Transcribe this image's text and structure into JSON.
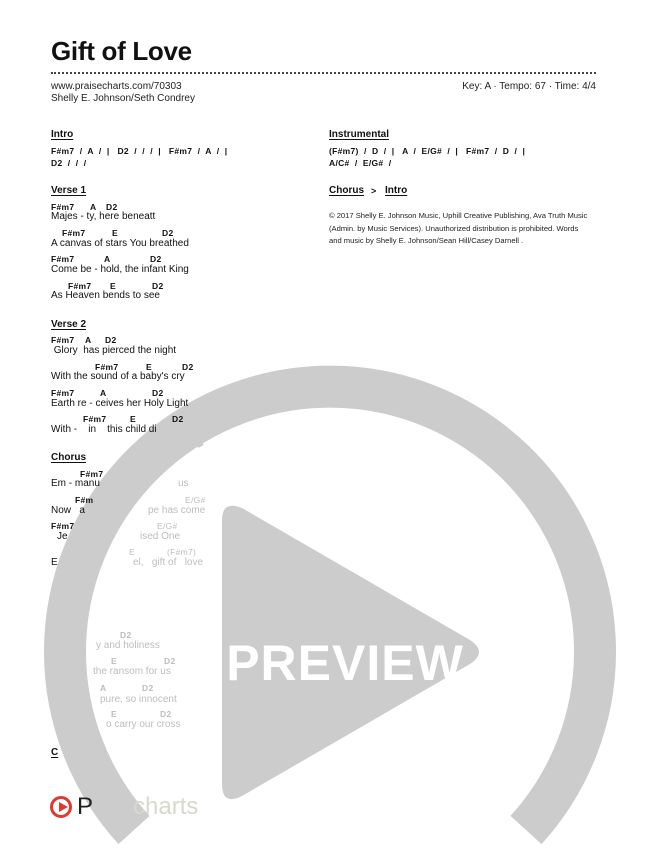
{
  "header": {
    "title": "Gift of Love",
    "url": "www.praisecharts.com/70303",
    "authors": "Shelly E. Johnson/Seth Condrey",
    "song_info": "Key: A · Tempo: 67 · Time: 4/4"
  },
  "intro": {
    "heading": "Intro",
    "lines": [
      "F#m7  /  A  /  |   D2  /  /  /  |   F#m7  /  A  /  |",
      "D2  /  /  /"
    ]
  },
  "verse1": {
    "heading": "Verse 1",
    "chords": [
      [
        "F#m7",
        "A",
        "D2"
      ],
      [
        "F#m7",
        "E",
        "D2"
      ],
      [
        "F#m7",
        "A",
        "D2"
      ],
      [
        "F#m7",
        "E",
        "D2"
      ]
    ],
    "lyrics": [
      "Majes - ty, here beneatt",
      "A canvas of stars You breathed",
      "Come be - hold, the infant King",
      "As Heaven bends to see"
    ]
  },
  "verse2": {
    "heading": "Verse 2",
    "chords": [
      [
        "F#m7",
        "A",
        "D2"
      ],
      [
        "F#m7",
        "E",
        "D2"
      ],
      [
        "F#m7",
        "A",
        "D2"
      ],
      [
        "F#m7",
        "E",
        "D2"
      ]
    ],
    "lyrics": [
      " Glory  has pierced the night",
      "With the sound of a baby's cry",
      "Earth re - ceives her Holy Light",
      "With -    in    this child di"
    ]
  },
  "chorus": {
    "heading": "Chorus",
    "chords": [
      "F#m7",
      "F#m",
      "E/G#",
      "F#m7",
      "E/G#",
      "E",
      "(F#m7)"
    ],
    "lyrics": [
      "Em - manu",
      "us",
      "Now   a",
      "pe has come",
      "Je",
      "ised One",
      "E",
      "el,   gift of   love"
    ]
  },
  "section4": {
    "chords": [
      "D2",
      "E",
      "D2",
      "A",
      "D2",
      "E",
      "D2"
    ],
    "lyrics": [
      "y and holiness",
      "the ransom for us",
      "pure, so innocent",
      "o carry our cross"
    ]
  },
  "section5": {
    "heading": "C"
  },
  "instrumental": {
    "heading": "Instrumental",
    "lines": [
      "(F#m7)  /  D  /  |   A  /  E/G#  /  |   F#m7  /  D  /  |",
      "A/C#  /  E/G#  /"
    ]
  },
  "roadmap": {
    "a": "Chorus",
    "sep": ">",
    "b": "Intro"
  },
  "copyright": "© 2017 Shelly E. Johnson Music, Uphill Creative Publishing, Ava Truth Music (Admin. by Music Services). Unauthorized distribution is prohibited. Words and music by Shelly E. Johnson/Sean Hill/Casey Darnell .",
  "watermark": {
    "url_text": "www.praisecharts.com",
    "preview_text": "PREVIEW",
    "color": "#cccccc"
  },
  "logo": {
    "text_a": "P",
    "text_b": "charts",
    "accent": "#e03a2f"
  }
}
